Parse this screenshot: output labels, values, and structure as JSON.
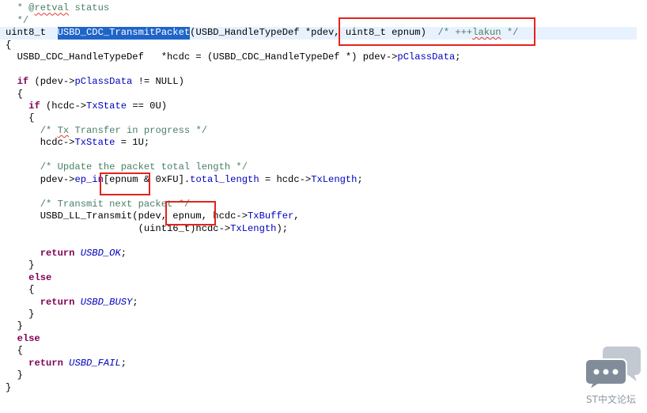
{
  "editor": {
    "fold_icon": "fold-toggle-icon",
    "colors": {
      "plain": "#000000",
      "keyword": "#7f0055",
      "field": "#0000c0",
      "comment": "#4a8066",
      "selection_bg": "#1f65c9",
      "selection_fg": "#ffffff",
      "current_line_bg": "#e8f2fe",
      "spelling": "#e8382f",
      "annotation": "#e3231f"
    },
    "lines": [
      {
        "tokens": [
          {
            "t": "  * @",
            "kind": "comment"
          },
          {
            "t": "retval",
            "kind": "comment",
            "spell": true
          },
          {
            "t": " status",
            "kind": "comment"
          }
        ]
      },
      {
        "tokens": [
          {
            "t": "  */",
            "kind": "comment"
          }
        ]
      },
      {
        "current": true,
        "tokens": [
          {
            "t": "uint8_t  ",
            "kind": "plain"
          },
          {
            "t": "USBD_CDC_TransmitPacket",
            "kind": "selection"
          },
          {
            "t": "(USBD_HandleTypeDef *pdev, uint8_t epnum)  ",
            "kind": "plain"
          },
          {
            "t": "/* +++",
            "kind": "comment"
          },
          {
            "t": "lakun",
            "kind": "comment",
            "spell": true
          },
          {
            "t": " */",
            "kind": "comment"
          }
        ]
      },
      {
        "tokens": [
          {
            "t": "{",
            "kind": "plain"
          }
        ]
      },
      {
        "tokens": [
          {
            "t": "  USBD_CDC_HandleTypeDef   *hcdc = (USBD_CDC_HandleTypeDef *) pdev->",
            "kind": "plain"
          },
          {
            "t": "pClassData",
            "kind": "field"
          },
          {
            "t": ";",
            "kind": "plain"
          }
        ]
      },
      {
        "tokens": []
      },
      {
        "tokens": [
          {
            "t": "  ",
            "kind": "plain"
          },
          {
            "t": "if",
            "kind": "keyword"
          },
          {
            "t": " (pdev->",
            "kind": "plain"
          },
          {
            "t": "pClassData",
            "kind": "field"
          },
          {
            "t": " != NULL)",
            "kind": "plain"
          }
        ]
      },
      {
        "tokens": [
          {
            "t": "  {",
            "kind": "plain"
          }
        ]
      },
      {
        "tokens": [
          {
            "t": "    ",
            "kind": "plain"
          },
          {
            "t": "if",
            "kind": "keyword"
          },
          {
            "t": " (hcdc->",
            "kind": "plain"
          },
          {
            "t": "TxState",
            "kind": "field"
          },
          {
            "t": " == 0U)",
            "kind": "plain"
          }
        ]
      },
      {
        "tokens": [
          {
            "t": "    {",
            "kind": "plain"
          }
        ]
      },
      {
        "tokens": [
          {
            "t": "      /* ",
            "kind": "comment"
          },
          {
            "t": "Tx",
            "kind": "comment",
            "spell": true
          },
          {
            "t": " Transfer in progress */",
            "kind": "comment"
          }
        ]
      },
      {
        "tokens": [
          {
            "t": "      hcdc->",
            "kind": "plain"
          },
          {
            "t": "TxState",
            "kind": "field"
          },
          {
            "t": " = 1U;",
            "kind": "plain"
          }
        ]
      },
      {
        "tokens": []
      },
      {
        "tokens": [
          {
            "t": "      /* Update the packet total length */",
            "kind": "comment"
          }
        ]
      },
      {
        "tokens": [
          {
            "t": "      pdev->",
            "kind": "plain"
          },
          {
            "t": "ep_in",
            "kind": "field"
          },
          {
            "t": "[epnum & 0xFU].",
            "kind": "plain"
          },
          {
            "t": "total_length",
            "kind": "field"
          },
          {
            "t": " = hcdc->",
            "kind": "plain"
          },
          {
            "t": "TxLength",
            "kind": "field"
          },
          {
            "t": ";",
            "kind": "plain"
          }
        ]
      },
      {
        "tokens": []
      },
      {
        "tokens": [
          {
            "t": "      /* Transmit next packet */",
            "kind": "comment"
          }
        ]
      },
      {
        "tokens": [
          {
            "t": "      USBD_LL_Transmit(pdev, epnum, hcdc->",
            "kind": "plain"
          },
          {
            "t": "TxBuffer",
            "kind": "field"
          },
          {
            "t": ",",
            "kind": "plain"
          }
        ]
      },
      {
        "tokens": [
          {
            "t": "                       (uint16_t)hcdc->",
            "kind": "plain"
          },
          {
            "t": "TxLength",
            "kind": "field"
          },
          {
            "t": ");",
            "kind": "plain"
          }
        ]
      },
      {
        "tokens": []
      },
      {
        "tokens": [
          {
            "t": "      ",
            "kind": "plain"
          },
          {
            "t": "return",
            "kind": "keyword"
          },
          {
            "t": " ",
            "kind": "plain"
          },
          {
            "t": "USBD_OK",
            "kind": "enum"
          },
          {
            "t": ";",
            "kind": "plain"
          }
        ]
      },
      {
        "tokens": [
          {
            "t": "    }",
            "kind": "plain"
          }
        ]
      },
      {
        "tokens": [
          {
            "t": "    ",
            "kind": "plain"
          },
          {
            "t": "else",
            "kind": "keyword"
          }
        ]
      },
      {
        "tokens": [
          {
            "t": "    {",
            "kind": "plain"
          }
        ]
      },
      {
        "tokens": [
          {
            "t": "      ",
            "kind": "plain"
          },
          {
            "t": "return",
            "kind": "keyword"
          },
          {
            "t": " ",
            "kind": "plain"
          },
          {
            "t": "USBD_BUSY",
            "kind": "enum"
          },
          {
            "t": ";",
            "kind": "plain"
          }
        ]
      },
      {
        "tokens": [
          {
            "t": "    }",
            "kind": "plain"
          }
        ]
      },
      {
        "tokens": [
          {
            "t": "  }",
            "kind": "plain"
          }
        ]
      },
      {
        "tokens": [
          {
            "t": "  ",
            "kind": "plain"
          },
          {
            "t": "else",
            "kind": "keyword"
          }
        ]
      },
      {
        "tokens": [
          {
            "t": "  {",
            "kind": "plain"
          }
        ]
      },
      {
        "tokens": [
          {
            "t": "    ",
            "kind": "plain"
          },
          {
            "t": "return",
            "kind": "keyword"
          },
          {
            "t": " ",
            "kind": "plain"
          },
          {
            "t": "USBD_FAIL",
            "kind": "enum"
          },
          {
            "t": ";",
            "kind": "plain"
          }
        ]
      },
      {
        "tokens": [
          {
            "t": "  }",
            "kind": "plain"
          }
        ]
      },
      {
        "tokens": [
          {
            "t": "}",
            "kind": "plain"
          }
        ]
      }
    ]
  },
  "watermark": {
    "icon": "chat-bubbles-icon",
    "text": "ST中文论坛",
    "color": "#8e98a2"
  }
}
